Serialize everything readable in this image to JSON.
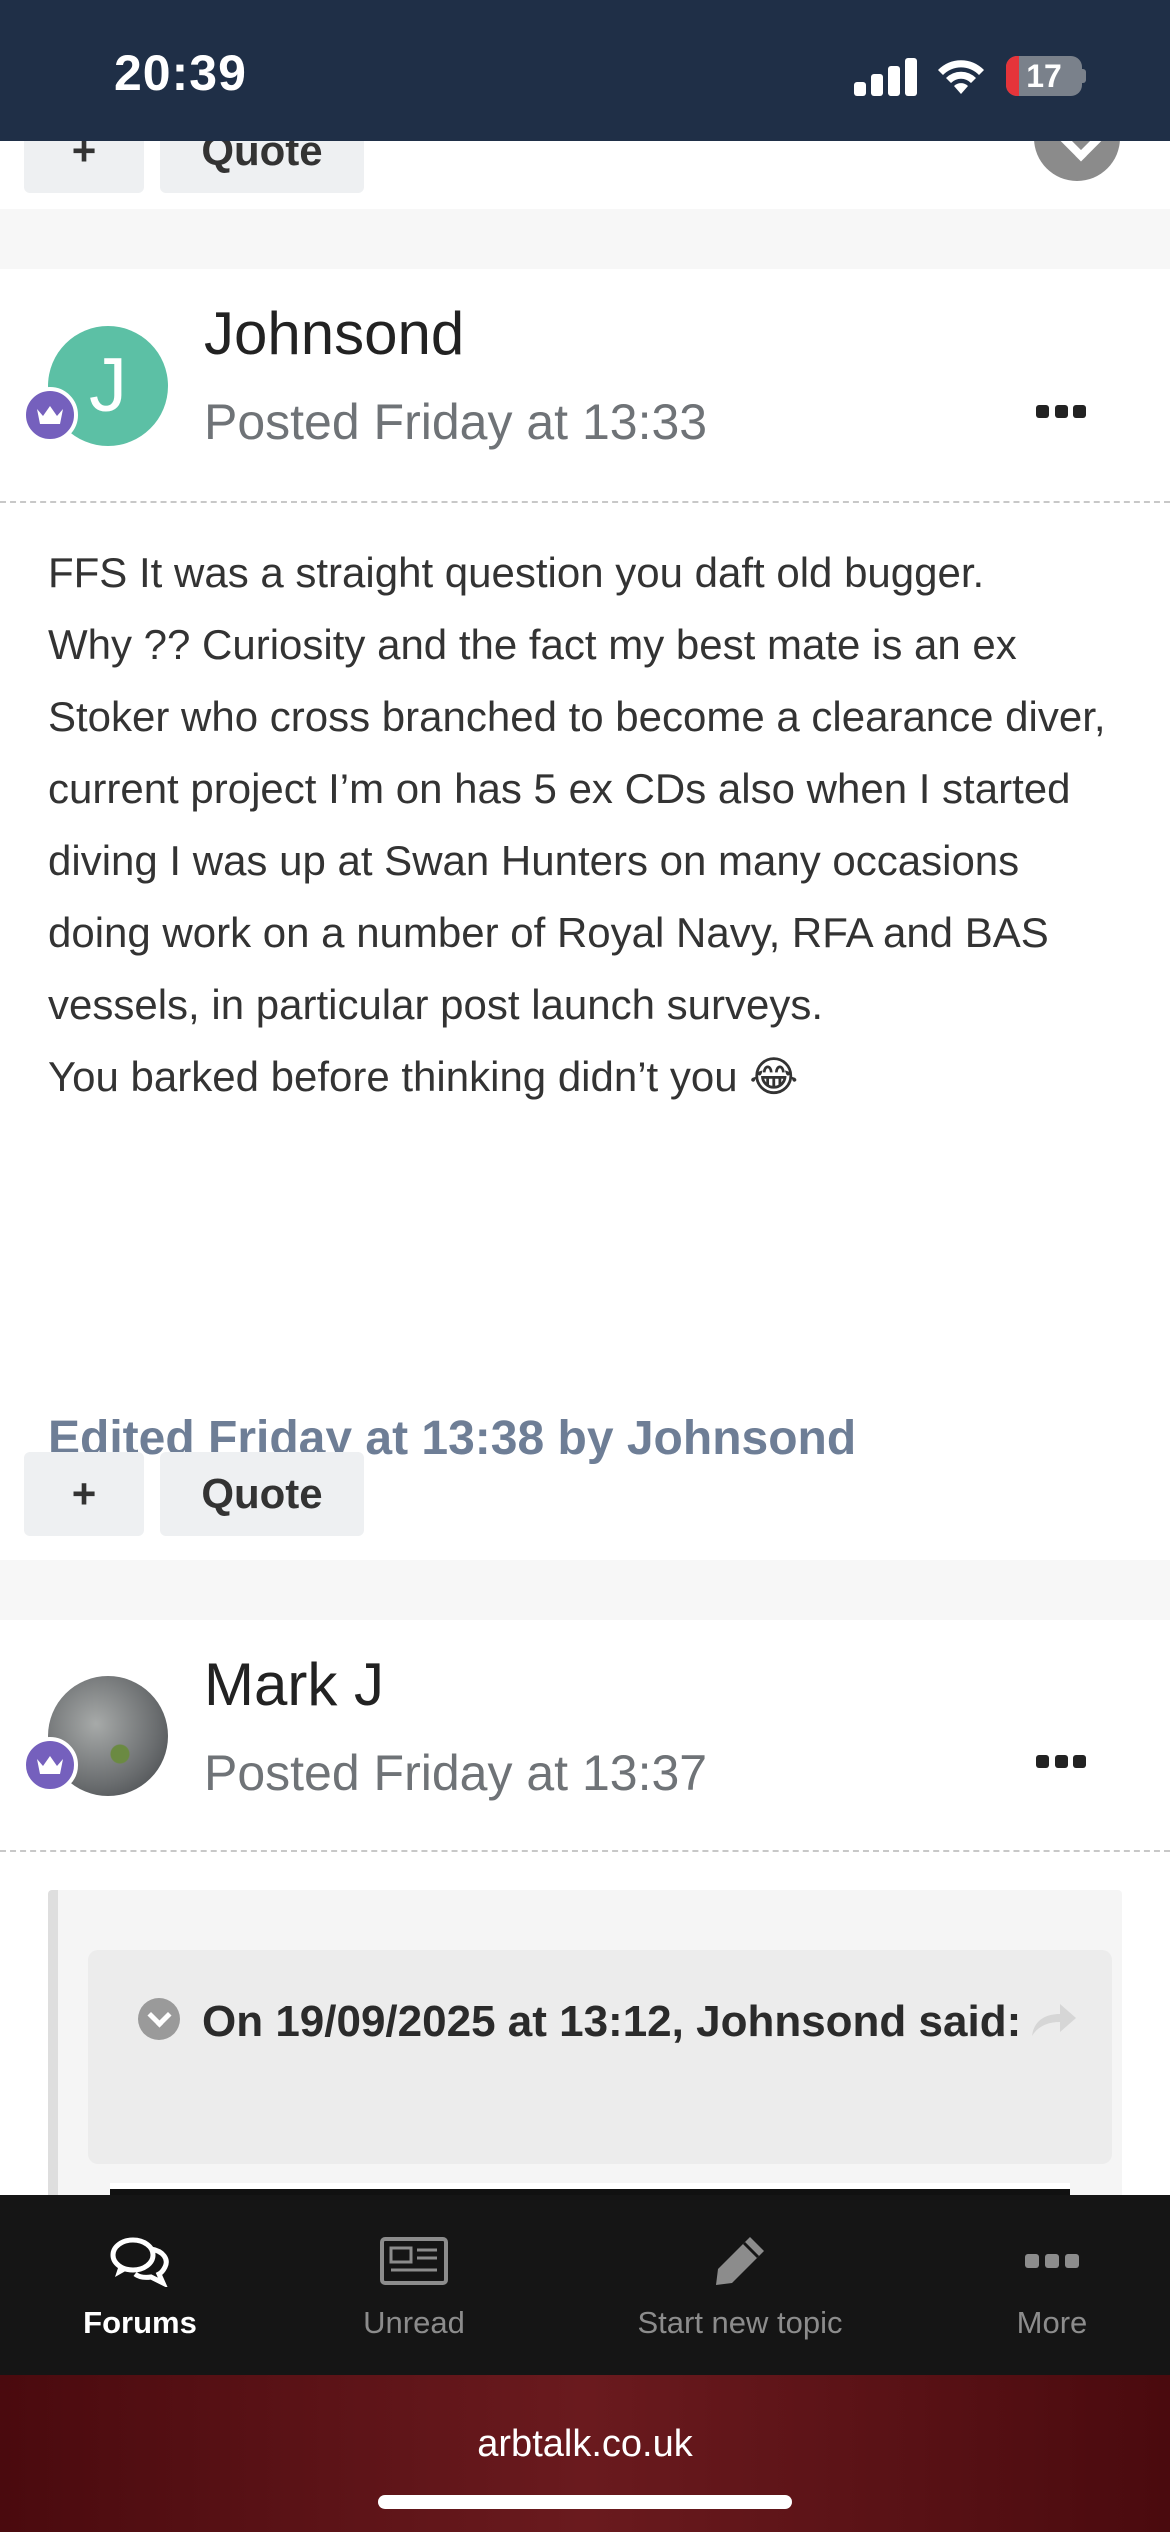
{
  "status_bar": {
    "time": "20:39",
    "battery_level": "17",
    "icons": [
      "signal-icon",
      "wifi-icon",
      "battery-icon"
    ]
  },
  "previous_post_actions": {
    "plus_label": "+",
    "quote_label": "Quote"
  },
  "posts": [
    {
      "author": "Johnsond",
      "avatar_letter": "J",
      "avatar_color": "#5cc0a5",
      "posted": "Posted Friday at 13:33",
      "body": [
        "FFS It was a straight question you daft old bugger.",
        "Why ?? Curiosity and the fact my best mate is an ex Stoker who cross branched to become a clearance diver, current project I’m on has 5 ex CDs also when I started diving I was up at Swan Hunters on many occasions doing work on a number of Royal Navy, RFA and BAS vessels, in particular post launch surveys.",
        "You barked before thinking didn’t you 😂"
      ],
      "edited": "Edited Friday at 13:38 by Johnsond",
      "plus_label": "+",
      "quote_label": "Quote"
    },
    {
      "author": "Mark J",
      "posted": "Posted Friday at 13:37",
      "quote": {
        "citation": "On 19/09/2025 at 13:12, Johnsond said:"
      }
    }
  ],
  "bottom_nav": {
    "items": [
      {
        "label": "Forums",
        "icon": "forums-icon",
        "active": true
      },
      {
        "label": "Unread",
        "icon": "newspaper-icon",
        "active": false
      },
      {
        "label": "Start new topic",
        "icon": "pencil-icon",
        "active": false
      },
      {
        "label": "More",
        "icon": "more-icon",
        "active": false
      }
    ]
  },
  "browser": {
    "url": "arbtalk.co.uk"
  },
  "colors": {
    "status_bar": "#1f2f47",
    "badge": "#7560bd",
    "edited_text": "#6e7e96",
    "site_bar": "#5a1015"
  }
}
